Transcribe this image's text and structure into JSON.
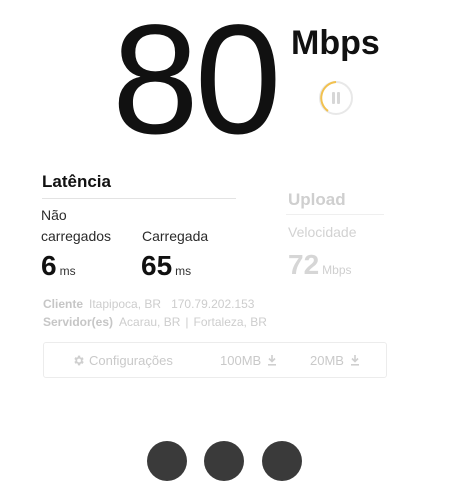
{
  "speed": {
    "value": "80",
    "unit": "Mbps"
  },
  "latency": {
    "title": "Latência",
    "unloaded_label": "Não carregados",
    "unloaded_value": "6",
    "unloaded_unit": "ms",
    "loaded_label": "Carregada",
    "loaded_value": "65",
    "loaded_unit": "ms"
  },
  "upload": {
    "title": "Upload",
    "speed_label": "Velocidade",
    "value": "72",
    "unit": "Mbps"
  },
  "connection": {
    "client_label": "Cliente",
    "client_location": "Itapipoca, BR",
    "client_ip": "170.79.202.153",
    "server_label": "Servidor(es)",
    "server_1": "Acarau, BR",
    "separator": "|",
    "server_2": "Fortaleza, BR"
  },
  "settings_bar": {
    "settings_label": "Configurações",
    "size_option_1": "100MB",
    "size_option_2": "20MB",
    "settings_icon": "gear-icon",
    "download_icon": "download-icon"
  },
  "colors": {
    "progress_accent": "#f2c14e",
    "faded_text": "#cdcdcd"
  }
}
